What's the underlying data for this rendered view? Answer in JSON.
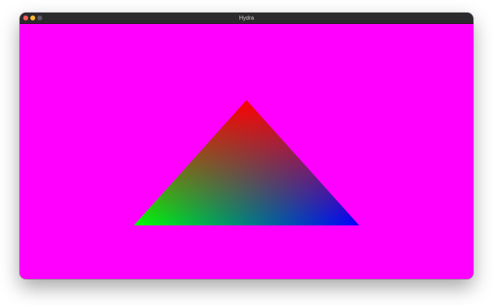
{
  "window": {
    "title": "Hydra"
  },
  "render": {
    "clear_color": "#ff00ff",
    "triangle": {
      "vertex_colors": [
        "#ff0000",
        "#00ff00",
        "#0000ff"
      ]
    }
  },
  "icons": {
    "close": "close-icon",
    "minimize": "minimize-icon",
    "zoom": "zoom-icon"
  }
}
